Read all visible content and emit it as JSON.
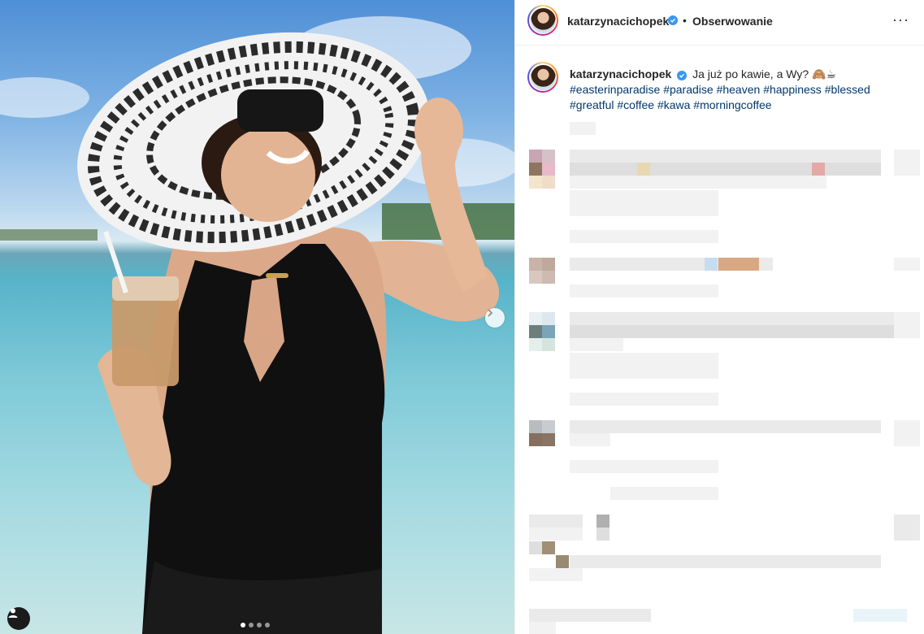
{
  "post": {
    "username": "katarzynacichopek",
    "follow_label": "Obserwowanie",
    "separator": "•",
    "more_label": "···",
    "caption_text": "Ja już po kawie, a Wy? 🙈☕",
    "hashtags": [
      "#easterinparadise",
      "#paradise",
      "#heaven",
      "#happiness",
      "#blessed",
      "#greatful",
      "#coffee",
      "#kawa",
      "#morningcoffee"
    ]
  },
  "carousel": {
    "slides": 4,
    "current": 1
  },
  "colors": {
    "link": "#00376b",
    "verified": "#3897f0",
    "border": "#efefef"
  },
  "icons": [
    "verified-badge-icon",
    "more-options-icon",
    "chevron-right-icon",
    "user-tag-icon"
  ]
}
